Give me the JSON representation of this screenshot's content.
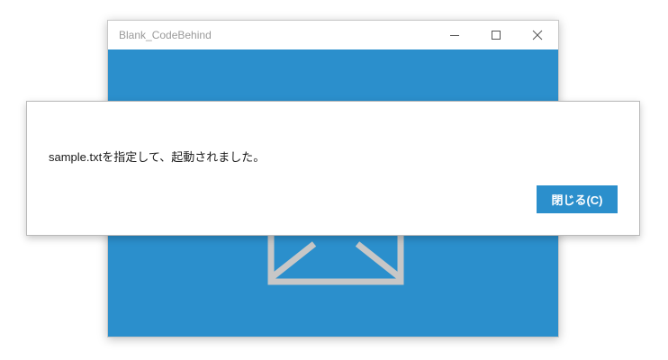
{
  "window": {
    "title": "Blank_CodeBehind",
    "controls": {
      "minimize_icon": "minimize-icon",
      "maximize_icon": "maximize-icon",
      "close_icon": "close-icon"
    },
    "content_background": "#2b8fcc",
    "content_icon": "envelope-icon"
  },
  "dialog": {
    "message": "sample.txtを指定して、起動されました。",
    "close_button_label": "閉じる(C)",
    "accent_color": "#2b8fcc"
  }
}
